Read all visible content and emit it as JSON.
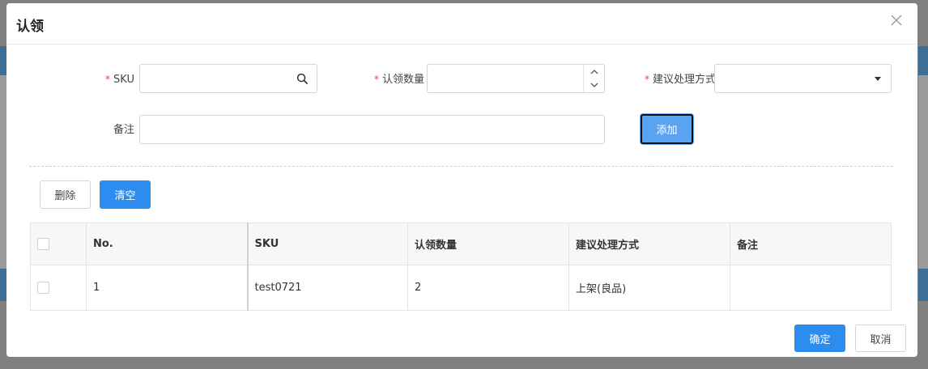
{
  "modal": {
    "title": "认领"
  },
  "form": {
    "sku_label": "SKU",
    "sku_value": "",
    "qty_label": "认领数量",
    "qty_value": "",
    "method_label": "建议处理方式",
    "method_value": "",
    "remark_label": "备注",
    "remark_value": "",
    "required_mark": "*",
    "add_button": "添加"
  },
  "actions": {
    "delete_button": "删除",
    "clear_button": "清空"
  },
  "table": {
    "columns": [
      "No.",
      "SKU",
      "认领数量",
      "建议处理方式",
      "备注"
    ],
    "rows": [
      {
        "no": "1",
        "sku": "test0721",
        "qty": "2",
        "method": "上架(良品)",
        "remark": ""
      }
    ]
  },
  "footer": {
    "confirm_button": "确定",
    "cancel_button": "取消"
  },
  "colors": {
    "primary": "#2d8cf0",
    "required": "#f04040"
  },
  "icons": [
    "close-icon",
    "search-icon",
    "chevron-up-icon",
    "chevron-down-icon",
    "caret-down-icon"
  ]
}
